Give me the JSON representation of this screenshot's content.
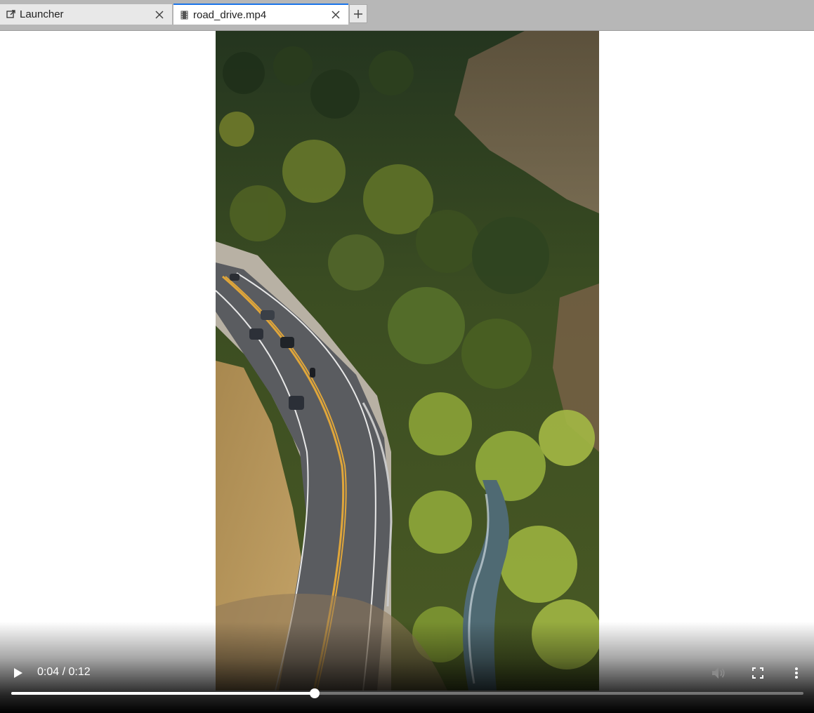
{
  "tabs": [
    {
      "label": "Launcher",
      "icon": "external-link-icon",
      "active": false
    },
    {
      "label": "road_drive.mp4",
      "icon": "film-icon",
      "active": true
    }
  ],
  "new_tab_icon": "plus-icon",
  "video": {
    "description_icon": "video-frame",
    "current_time": "0:04",
    "duration": "0:12",
    "time_text": "0:04 / 0:12",
    "progress_fraction": 0.383
  },
  "controls": {
    "play_icon": "play-icon",
    "mute_icon": "volume-icon",
    "fullscreen_icon": "fullscreen-icon",
    "more_icon": "more-vertical-icon"
  },
  "colors": {
    "active_tab_accent": "#1a73e8",
    "tabbar_bg": "#b7b7b7"
  }
}
